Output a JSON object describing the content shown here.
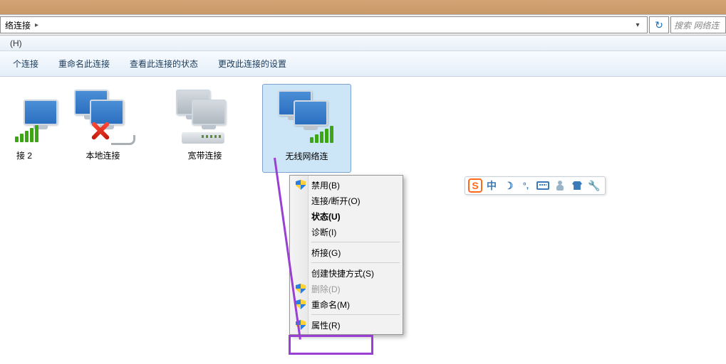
{
  "breadcrumb": {
    "segment": "络连接",
    "arrow": "▸"
  },
  "address": {
    "dropdown_glyph": "▾",
    "refresh_glyph": "↻"
  },
  "search": {
    "placeholder": "搜索 网络连"
  },
  "menubar": {
    "help": "(H)"
  },
  "toolbar": {
    "btn1": "个连接",
    "btn2": "重命名此连接",
    "btn3": "查看此连接的状态",
    "btn4": "更改此连接的设置"
  },
  "connections": {
    "item0": {
      "label": "接 2"
    },
    "item1": {
      "label": "本地连接"
    },
    "item2": {
      "label": "宽带连接"
    },
    "item3": {
      "label": "无线网络连"
    }
  },
  "context_menu": {
    "disable": "禁用(B)",
    "connect": "连接/断开(O)",
    "status": "状态(U)",
    "diagnose": "诊断(I)",
    "bridge": "桥接(G)",
    "shortcut": "创建快捷方式(S)",
    "delete": "删除(D)",
    "rename": "重命名(M)",
    "properties": "属性(R)"
  },
  "ime": {
    "logo": "S",
    "zhong": "中",
    "moon": "☽",
    "punct": "°,"
  }
}
